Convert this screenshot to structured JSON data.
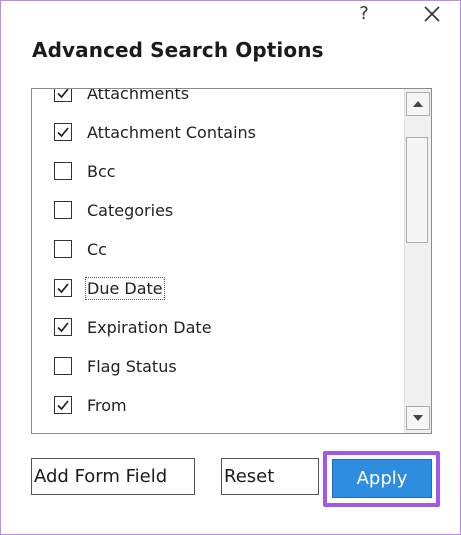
{
  "dialog": {
    "title": "Advanced Search Options",
    "help_label": "?",
    "close_icon": "close-icon"
  },
  "fields": [
    {
      "label": "Attachments",
      "checked": true
    },
    {
      "label": "Attachment Contains",
      "checked": true
    },
    {
      "label": "Bcc",
      "checked": false
    },
    {
      "label": "Categories",
      "checked": false
    },
    {
      "label": "Cc",
      "checked": false
    },
    {
      "label": "Due Date",
      "checked": true,
      "focused": true
    },
    {
      "label": "Expiration Date",
      "checked": true
    },
    {
      "label": "Flag Status",
      "checked": false
    },
    {
      "label": "From",
      "checked": true
    },
    {
      "label": "",
      "checked": false
    }
  ],
  "scrollbar": {
    "up_icon": "scroll-up-arrow-icon",
    "down_icon": "scroll-down-arrow-icon"
  },
  "buttons": {
    "add_form_field": "Add Form Field",
    "reset": "Reset",
    "apply": "Apply"
  },
  "colors": {
    "highlight": "#a259e3",
    "apply_bg": "#2f8de0"
  }
}
